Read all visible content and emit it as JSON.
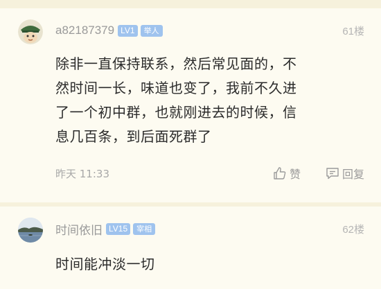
{
  "comments": [
    {
      "username": "a82187379",
      "level": "LV1",
      "rank": "举人",
      "floor": "61楼",
      "lines": [
        "除非一直保持联系，然后常见面的，不",
        "然时间一长，味道也变了，我前不久进",
        "了一个初中群，也就刚进去的时候，信",
        "息几百条，到后面死群了"
      ],
      "time": "昨天 11:33",
      "like_label": "赞",
      "reply_label": "回复",
      "avatar_icon": "green-hat-cartoon-avatar"
    },
    {
      "username": "时间依旧",
      "level": "LV15",
      "rank": "宰相",
      "floor": "62楼",
      "lines": [
        "时间能冲淡一切"
      ],
      "avatar_icon": "lake-landscape-avatar"
    }
  ],
  "colors": {
    "background": "#f6f1dc",
    "card": "#fdfbf1",
    "badge": "#9fc3ee",
    "text": "#2b2b2b",
    "meta": "#9a9a9a"
  }
}
